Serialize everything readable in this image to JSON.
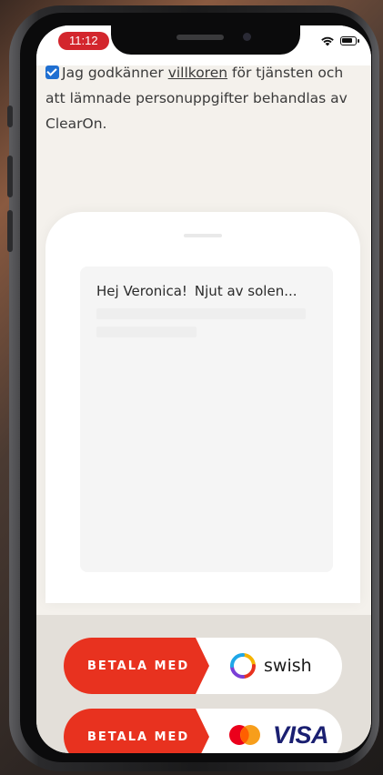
{
  "status_bar": {
    "time": "11:12",
    "time_pill_color": "#d3262d",
    "icons": [
      "wifi-icon",
      "battery-icon"
    ]
  },
  "consent": {
    "checked": true,
    "text_before_link": "Jag godkänner ",
    "link_text": "villkoren",
    "text_after_link": " för tjänsten och att lämnade personuppgifter behandlas av ClearOn."
  },
  "preview": {
    "greeting_name": "Hej Veronica!",
    "message": "Njut av solen..."
  },
  "payment": {
    "swish_button": {
      "label": "BETALA MED",
      "provider_text": "swish",
      "provider_icon": "swish-logo-icon"
    },
    "card_button": {
      "label": "BETALA MED",
      "provider_text": "VISA",
      "provider_icon": "mastercard-logo-icon"
    },
    "accent_color": "#e8321f"
  }
}
